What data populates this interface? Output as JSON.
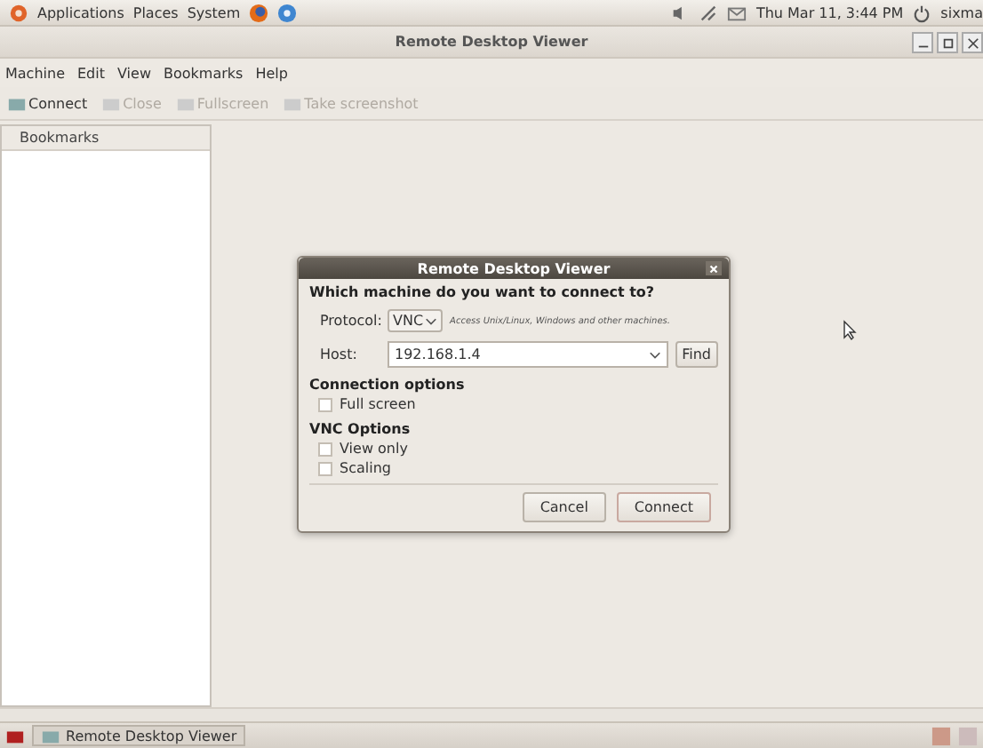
{
  "top_panel": {
    "menus": [
      "Applications",
      "Places",
      "System"
    ],
    "clock": "Thu Mar 11,  3:44 PM",
    "user": "sixma"
  },
  "window": {
    "title": "Remote Desktop Viewer",
    "menu": [
      "Machine",
      "Edit",
      "View",
      "Bookmarks",
      "Help"
    ],
    "toolbar": [
      {
        "label": "Connect",
        "disabled": false
      },
      {
        "label": "Close",
        "disabled": true
      },
      {
        "label": "Fullscreen",
        "disabled": true
      },
      {
        "label": "Take screenshot",
        "disabled": true
      }
    ],
    "sidebar": {
      "header": "Bookmarks"
    }
  },
  "dialog": {
    "title": "Remote Desktop Viewer",
    "heading": "Which machine do you want to connect to?",
    "protocol_label": "Protocol:",
    "protocol": "VNC",
    "protocol_hint": "Access Unix/Linux, Windows and other machines.",
    "host_label": "Host:",
    "host": "192.168.1.4",
    "find": "Find",
    "sections": [
      {
        "title": "Connection options",
        "options": [
          {
            "label": "Full screen",
            "checked": false
          }
        ]
      },
      {
        "title": "VNC Options",
        "options": [
          {
            "label": "View only",
            "checked": false
          },
          {
            "label": "Scaling",
            "checked": false
          }
        ]
      }
    ],
    "buttons": [
      "Cancel",
      "Connect"
    ]
  },
  "taskbar": {
    "task": "Remote Desktop Viewer"
  }
}
